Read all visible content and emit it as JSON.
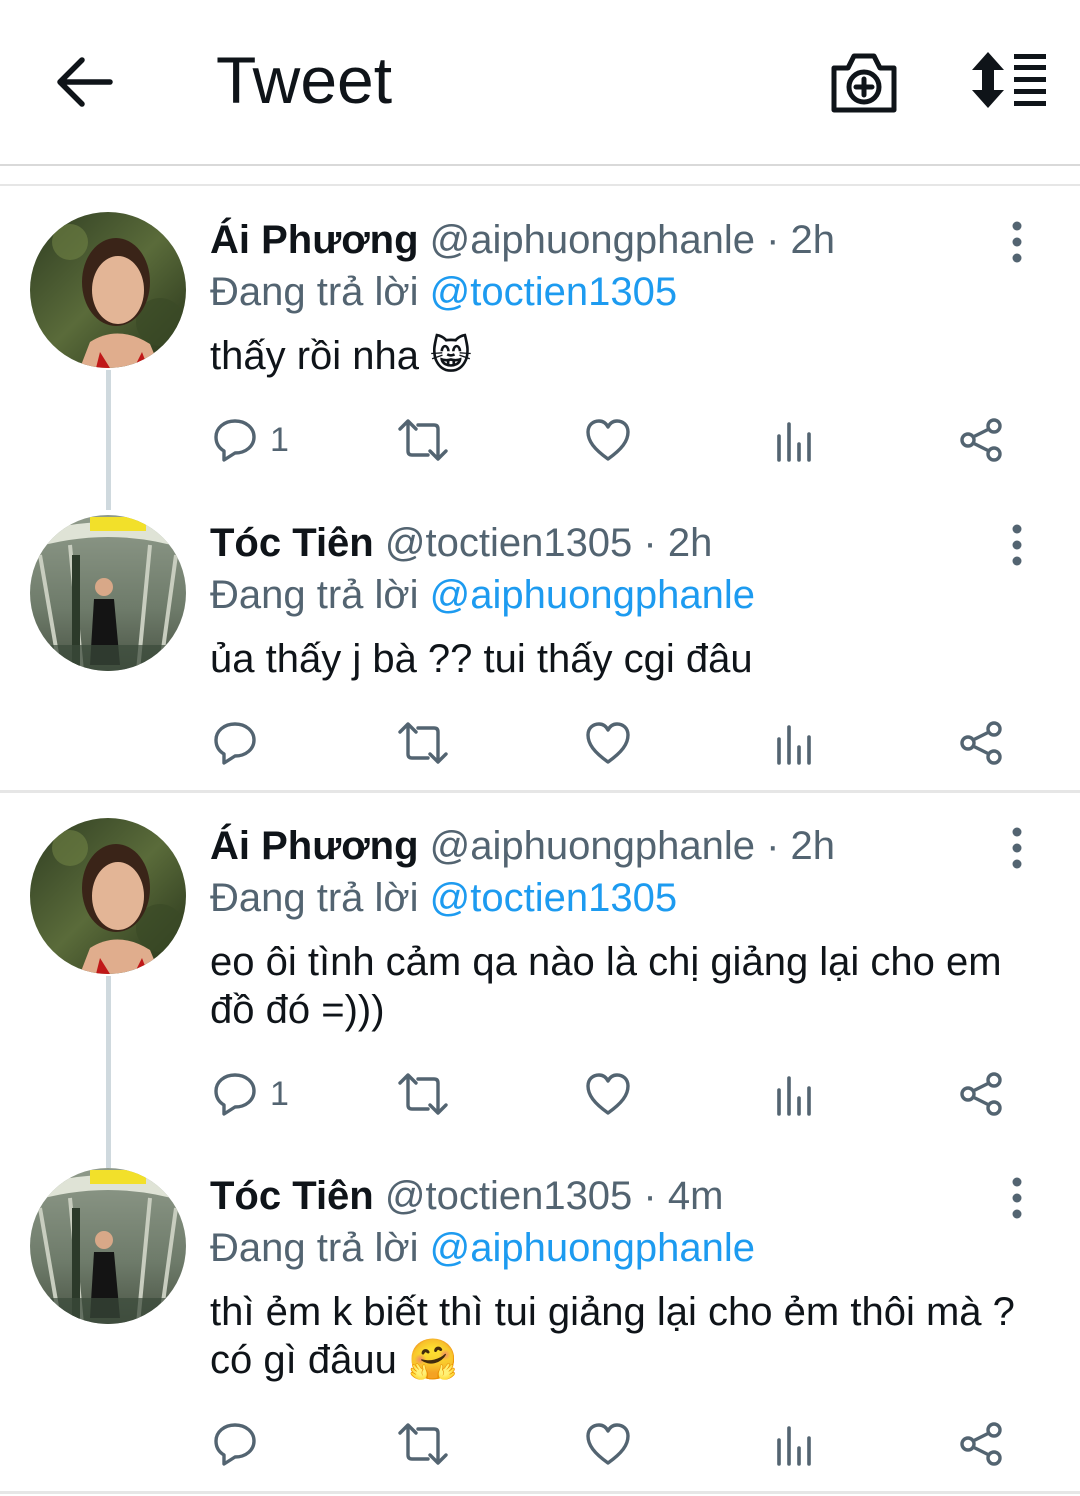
{
  "header": {
    "title": "Tweet",
    "icons": [
      "back-arrow-icon",
      "camera-add-icon",
      "sort-thread-icon"
    ]
  },
  "colors": {
    "link": "#1d9bf0",
    "secondary_text": "#536471",
    "primary_text": "#0f1419",
    "divider": "#e6e6e6"
  },
  "tweets": [
    {
      "name": "Ái Phương",
      "handle": "@aiphuongphanle",
      "time": " · 2h",
      "replying_label": "Đang trả lời ",
      "replying_to": "@toctien1305",
      "text": "thấy rồi nha ",
      "emoji": "😸",
      "reply_count": "1"
    },
    {
      "name": "Tóc Tiên",
      "handle": "@toctien1305",
      "time": " · 2h",
      "replying_label": "Đang trả lời ",
      "replying_to": "@aiphuongphanle",
      "text": "ủa thấy j bà ?? tui thấy cgi đâu",
      "emoji": "",
      "reply_count": ""
    },
    {
      "name": "Ái Phương",
      "handle": "@aiphuongphanle",
      "time": " · 2h",
      "replying_label": "Đang trả lời ",
      "replying_to": "@toctien1305",
      "text": "eo ôi tình cảm qa nào là chị giảng lại cho em đồ đó =)))",
      "emoji": "",
      "reply_count": "1"
    },
    {
      "name": "Tóc Tiên",
      "handle": "@toctien1305",
      "time": " · 4m",
      "replying_label": "Đang trả lời ",
      "replying_to": "@aiphuongphanle",
      "text": "thì ẻm k biết thì tui giảng lại cho ẻm thôi mà ? có gì đâuu ",
      "emoji": "🤗",
      "reply_count": ""
    }
  ]
}
